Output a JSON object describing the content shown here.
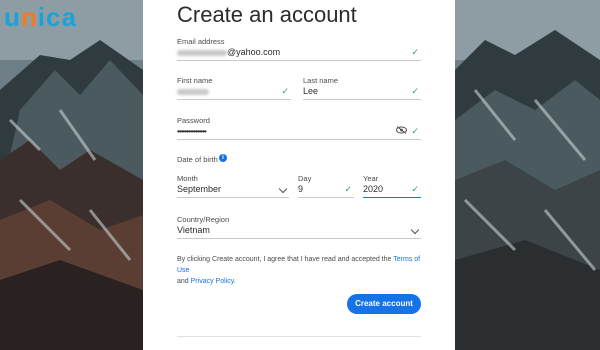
{
  "logo": {
    "u": "u",
    "n": "n",
    "i": "i",
    "c": "c",
    "a": "a"
  },
  "form": {
    "title": "Create an account",
    "email": {
      "label": "Email address",
      "value_suffix": "@yahoo.com"
    },
    "first_name": {
      "label": "First name"
    },
    "last_name": {
      "label": "Last name",
      "value": "Lee"
    },
    "password": {
      "label": "Password",
      "value": "••••••••••••••••"
    },
    "dob": {
      "label": "Date of birth",
      "month": {
        "label": "Month",
        "value": "September"
      },
      "day": {
        "label": "Day",
        "value": "9"
      },
      "year": {
        "label": "Year",
        "value": "2020"
      }
    },
    "country": {
      "label": "Country/Region",
      "value": "Vietnam"
    },
    "terms": {
      "prefix": "By clicking Create account, I agree that I have read and accepted the ",
      "terms_link": "Terms of Use",
      "and": "and",
      "privacy_link": "Privacy Policy."
    },
    "submit_label": "Create account"
  },
  "icons": {
    "check": "✓",
    "info": "i"
  },
  "colors": {
    "accent": "#1473e6",
    "check": "#2d9d78",
    "logo_blue": "#1aa3d9",
    "logo_orange": "#f07b22"
  }
}
